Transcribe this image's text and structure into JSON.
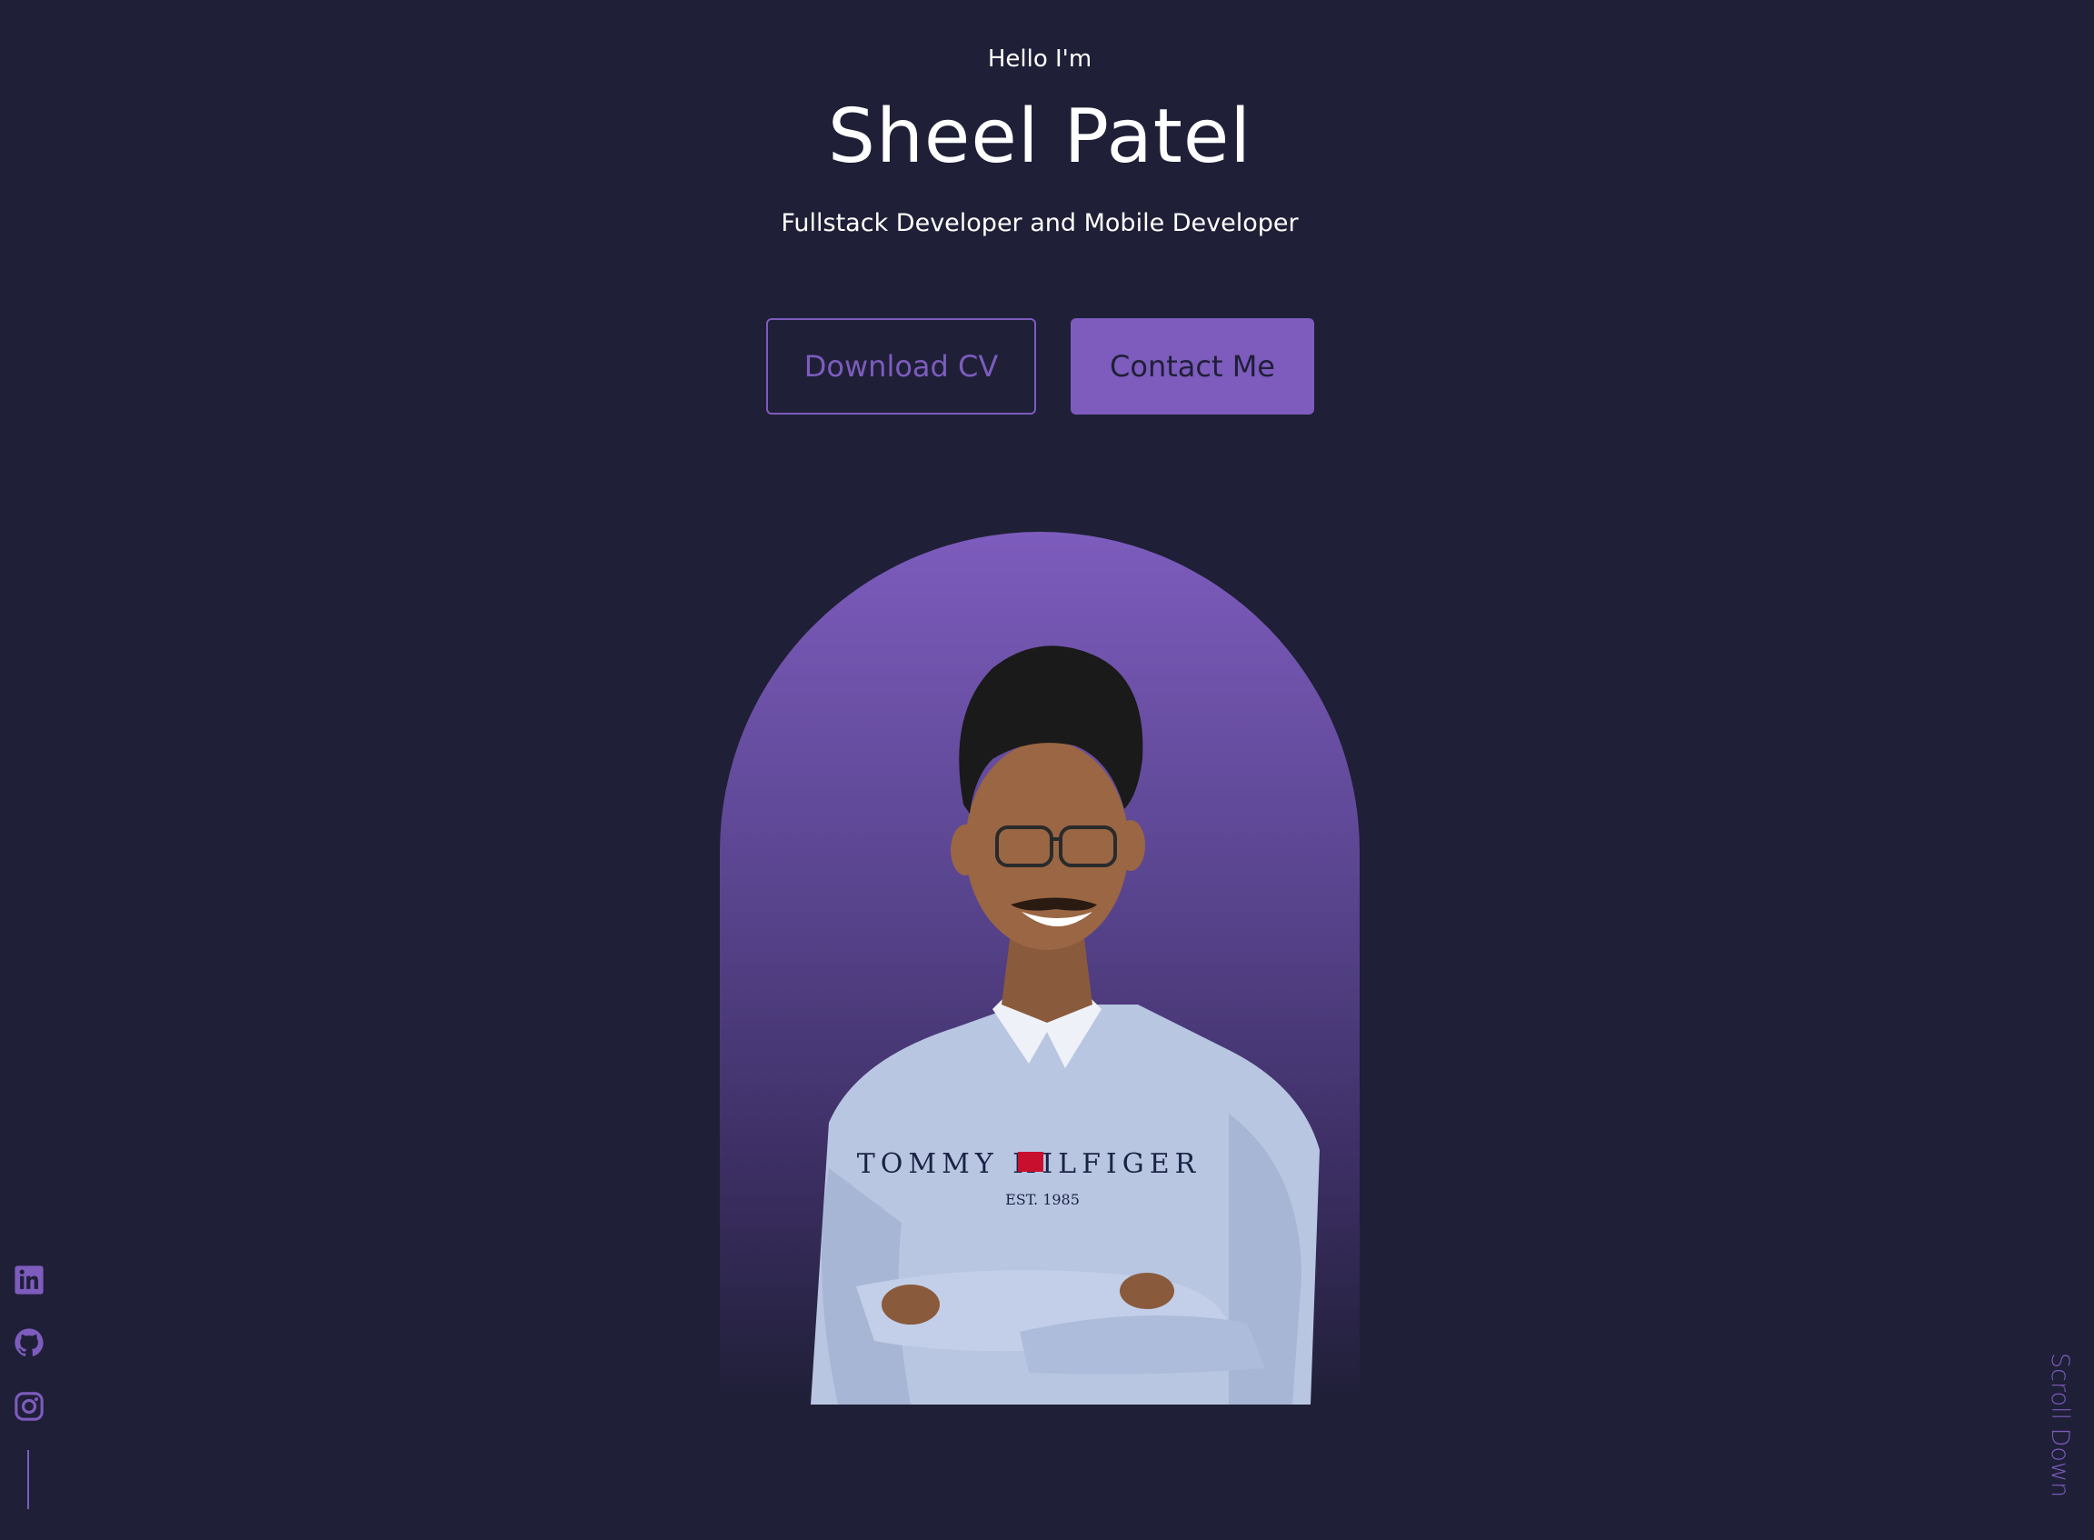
{
  "hero": {
    "greeting": "Hello I'm",
    "name": "Sheel Patel",
    "role": "Fullstack Developer and Mobile Developer"
  },
  "buttons": {
    "download_cv": "Download CV",
    "contact_me": "Contact Me"
  },
  "portrait": {
    "shirt_brand": "TOMMY HILFIGER",
    "shirt_est": "EST. 1985"
  },
  "social": [
    {
      "icon": "linkedin-icon"
    },
    {
      "icon": "github-icon"
    },
    {
      "icon": "instagram-icon"
    }
  ],
  "scroll_down": "Scroll Down",
  "colors": {
    "background": "#1f1f37",
    "accent": "#7d5cbd",
    "text": "#ffffff"
  }
}
